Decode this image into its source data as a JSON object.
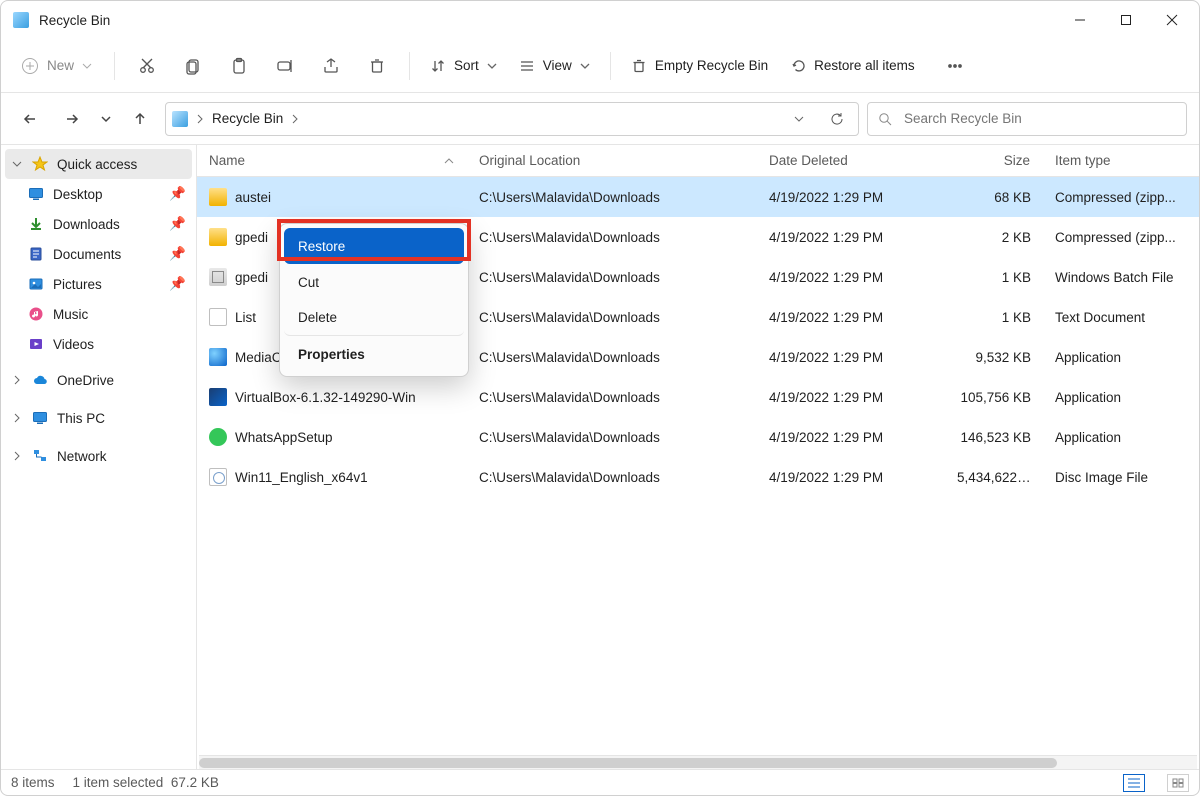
{
  "window": {
    "title": "Recycle Bin"
  },
  "toolbar": {
    "new": "New",
    "sort": "Sort",
    "view": "View",
    "empty": "Empty Recycle Bin",
    "restore_all": "Restore all items"
  },
  "address": {
    "crumb": "Recycle Bin"
  },
  "search": {
    "placeholder": "Search Recycle Bin"
  },
  "sidebar": {
    "quick_access": "Quick access",
    "items": [
      {
        "label": "Desktop",
        "pinned": true
      },
      {
        "label": "Downloads",
        "pinned": true
      },
      {
        "label": "Documents",
        "pinned": true
      },
      {
        "label": "Pictures",
        "pinned": true
      },
      {
        "label": "Music",
        "pinned": false
      },
      {
        "label": "Videos",
        "pinned": false
      }
    ],
    "onedrive": "OneDrive",
    "this_pc": "This PC",
    "network": "Network"
  },
  "columns": {
    "name": "Name",
    "original_location": "Original Location",
    "date_deleted": "Date Deleted",
    "size": "Size",
    "item_type": "Item type"
  },
  "rows": [
    {
      "name": "austei",
      "location": "C:\\Users\\Malavida\\Downloads",
      "date": "4/19/2022 1:29 PM",
      "size": "68 KB",
      "type": "Compressed (zipp...",
      "icon": "zip",
      "selected": true
    },
    {
      "name": "gpedi",
      "location": "C:\\Users\\Malavida\\Downloads",
      "date": "4/19/2022 1:29 PM",
      "size": "2 KB",
      "type": "Compressed (zipp...",
      "icon": "zip"
    },
    {
      "name": "gpedi",
      "location": "C:\\Users\\Malavida\\Downloads",
      "date": "4/19/2022 1:29 PM",
      "size": "1 KB",
      "type": "Windows Batch File",
      "icon": "bat"
    },
    {
      "name": "List",
      "location": "C:\\Users\\Malavida\\Downloads",
      "date": "4/19/2022 1:29 PM",
      "size": "1 KB",
      "type": "Text Document",
      "icon": "txt"
    },
    {
      "name": "MediaCreationToolW11",
      "location": "C:\\Users\\Malavida\\Downloads",
      "date": "4/19/2022 1:29 PM",
      "size": "9,532 KB",
      "type": "Application",
      "icon": "app1"
    },
    {
      "name": "VirtualBox-6.1.32-149290-Win",
      "location": "C:\\Users\\Malavida\\Downloads",
      "date": "4/19/2022 1:29 PM",
      "size": "105,756 KB",
      "type": "Application",
      "icon": "app2"
    },
    {
      "name": "WhatsAppSetup",
      "location": "C:\\Users\\Malavida\\Downloads",
      "date": "4/19/2022 1:29 PM",
      "size": "146,523 KB",
      "type": "Application",
      "icon": "app3"
    },
    {
      "name": "Win11_English_x64v1",
      "location": "C:\\Users\\Malavida\\Downloads",
      "date": "4/19/2022 1:29 PM",
      "size": "5,434,622 ...",
      "type": "Disc Image File",
      "icon": "iso"
    }
  ],
  "context_menu": {
    "restore": "Restore",
    "cut": "Cut",
    "delete": "Delete",
    "properties": "Properties"
  },
  "status": {
    "count": "8 items",
    "selection": "1 item selected",
    "size": "67.2 KB"
  }
}
